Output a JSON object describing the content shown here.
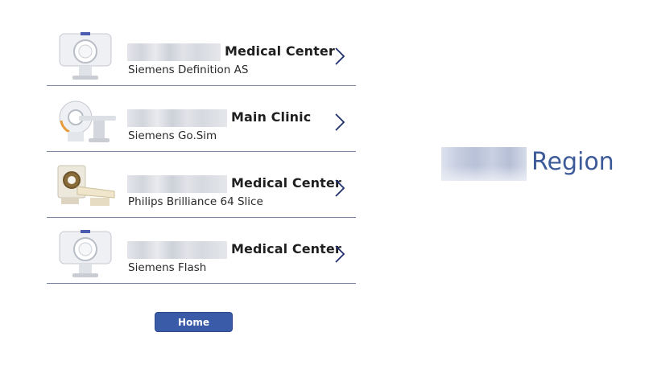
{
  "locations": [
    {
      "center_name": "Medical Center",
      "machine": "Siemens Definition AS",
      "icon": "ct-scanner-icon"
    },
    {
      "center_name": "Main Clinic",
      "machine": "Siemens Go.Sim",
      "icon": "ct-scanner-icon"
    },
    {
      "center_name": "Medical Center",
      "machine": "Philips Brilliance 64 Slice",
      "icon": "ct-scanner-icon"
    },
    {
      "center_name": "Medical Center",
      "machine": "Siemens Flash",
      "icon": "ct-scanner-icon"
    }
  ],
  "region": {
    "label": "Region"
  },
  "home_button": {
    "label": "Home"
  },
  "colors": {
    "accent": "#3a5ca8",
    "region_text": "#3d5a99",
    "divider": "#7d86a3",
    "chevron": "#1f2f6e"
  }
}
